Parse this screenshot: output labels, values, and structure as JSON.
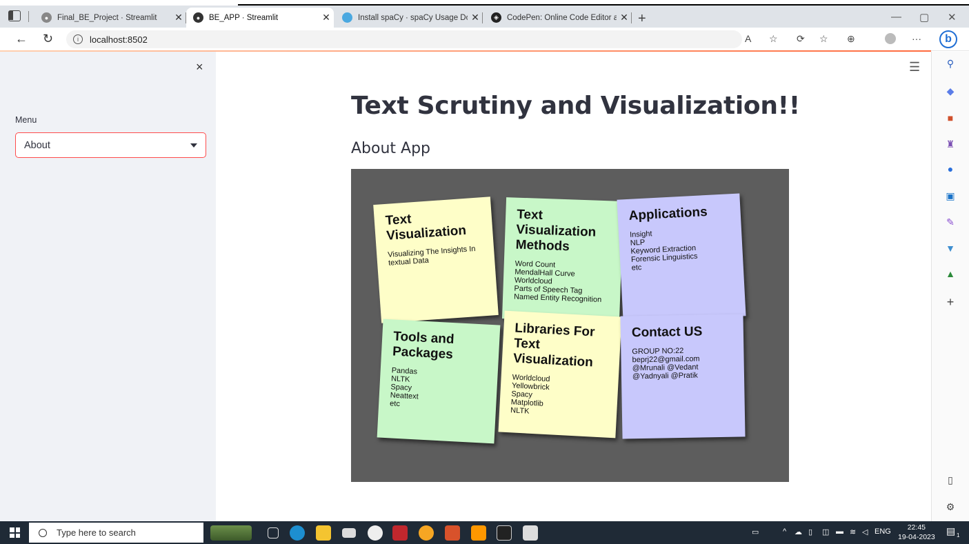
{
  "browser": {
    "tabs": [
      {
        "title": "Final_BE_Project · Streamlit"
      },
      {
        "title": "BE_APP · Streamlit"
      },
      {
        "title": "Install spaCy · spaCy Usage Docu"
      },
      {
        "title": "CodePen: Online Code Editor anc"
      }
    ],
    "new_tab": "+",
    "url": "localhost:8502",
    "bing_label": "b"
  },
  "sidebar": {
    "close": "×",
    "menu_label": "Menu",
    "selected": "About"
  },
  "main": {
    "title": "Text Scrutiny and Visualization!!",
    "subtitle": "About App"
  },
  "notes": [
    {
      "color": "yellow",
      "title": [
        "Text",
        "Visualization"
      ],
      "lines": [
        "Visualizing The Insights In",
        "textual Data"
      ]
    },
    {
      "color": "green",
      "title": [
        "Text",
        "Visualization",
        "Methods"
      ],
      "lines": [
        "Word Count",
        "MendalHall Curve",
        "Worldcloud",
        "Parts of Speech Tag",
        "Named Entity Recognition"
      ]
    },
    {
      "color": "purple",
      "title": [
        "Applications"
      ],
      "lines": [
        "Insight",
        "NLP",
        "Keyword Extraction",
        "Forensic Linguistics",
        "etc"
      ]
    },
    {
      "color": "green",
      "title": [
        "Tools and",
        "Packages"
      ],
      "lines": [
        "Pandas",
        "NLTK",
        "Spacy",
        "Neattext",
        "etc"
      ]
    },
    {
      "color": "yellow",
      "title": [
        "Libraries For",
        "Text",
        "Visualization"
      ],
      "lines": [
        "Worldcloud",
        "Yellowbrick",
        "Spacy",
        "Matplotlib",
        "NLTK"
      ]
    },
    {
      "color": "purple",
      "title": [
        "Contact US"
      ],
      "lines": [
        "GROUP NO:22",
        "beprj22@gmail.com",
        "@Mrunali @Vedant",
        "@Yadnyali @Pratik"
      ]
    }
  ],
  "taskbar": {
    "search_placeholder": "Type here to search",
    "lang": "ENG",
    "time": "22:45",
    "date": "19-04-2023",
    "notification_count": "1"
  }
}
